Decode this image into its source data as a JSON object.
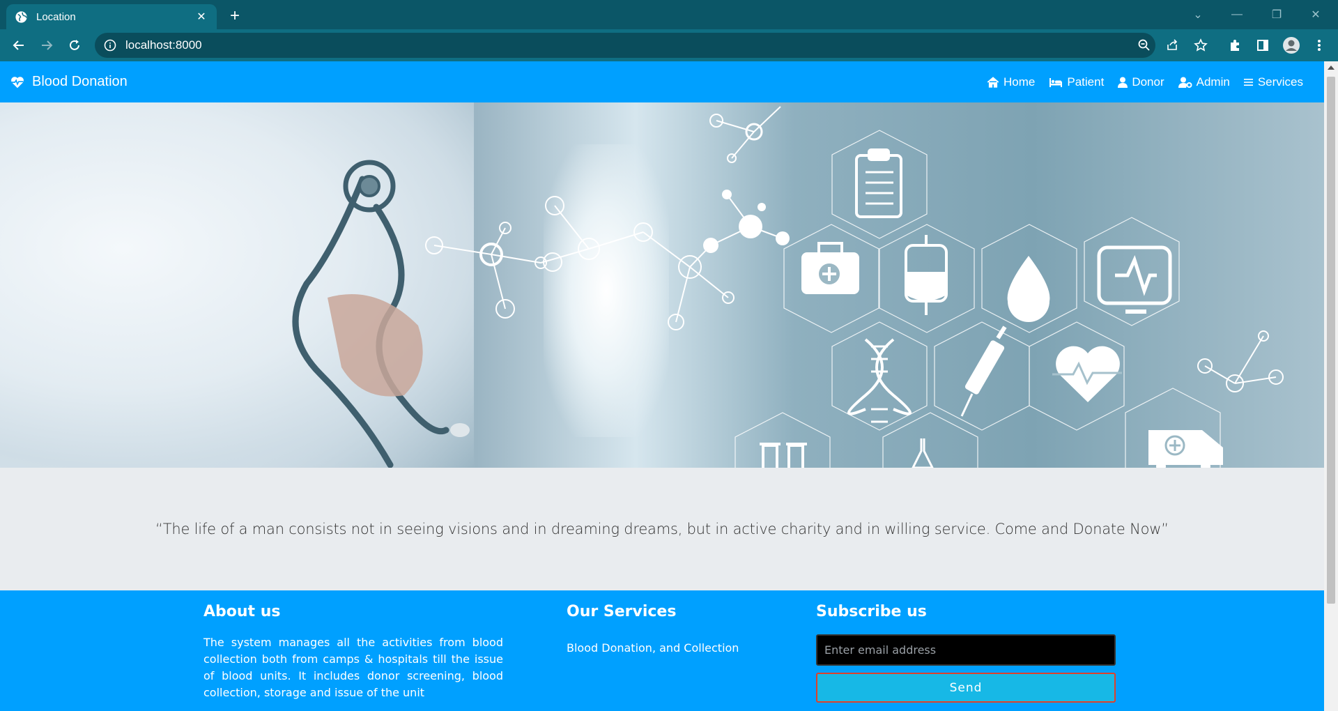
{
  "browser": {
    "tab_title": "Location",
    "url": "localhost:8000"
  },
  "navbar": {
    "brand": "Blood Donation",
    "links": [
      {
        "label": "Home",
        "icon": "home-icon"
      },
      {
        "label": "Patient",
        "icon": "bed-icon"
      },
      {
        "label": "Donor",
        "icon": "user-icon"
      },
      {
        "label": "Admin",
        "icon": "user-cog-icon"
      },
      {
        "label": "Services",
        "icon": "menu-icon"
      }
    ]
  },
  "hero": {
    "image": "doctor-with-stethoscope-and-medical-icons"
  },
  "quote": "“The life of a man consists not in seeing visions and in dreaming dreams, but in active charity and in willing service. Come and Donate Now”",
  "footer": {
    "about": {
      "title": "About us",
      "text": "The system manages all the activities from blood collection both from camps & hospitals till the issue of blood units. It includes donor screening, blood collection, storage and issue of the unit"
    },
    "services": {
      "title": "Our Services",
      "item": "Blood Donation, and Collection"
    },
    "subscribe": {
      "title": "Subscribe us",
      "placeholder": "Enter email address",
      "button": "Send"
    }
  },
  "colors": {
    "chrome": "#0b5667",
    "toolbar": "#0f6e82",
    "primary": "#00a0ff",
    "band": "#e9ecef",
    "send_button": "#17b8e6",
    "send_border": "#e0402a"
  }
}
